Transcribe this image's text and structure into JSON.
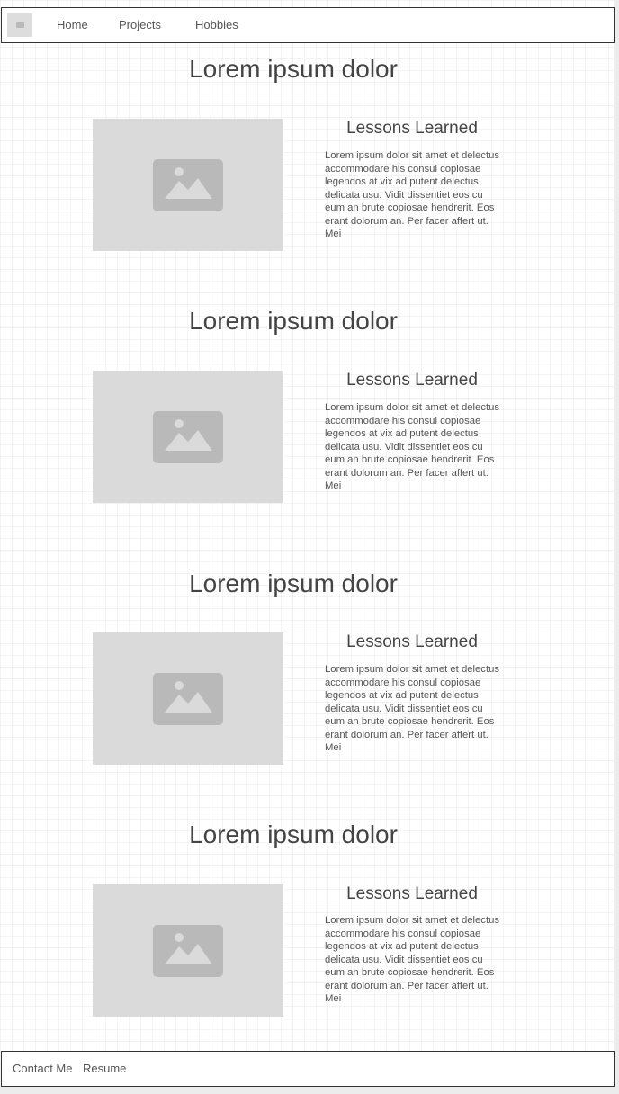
{
  "nav": {
    "logo_icon": "image-placeholder-icon",
    "links": [
      "Home",
      "Projects",
      "Hobbies"
    ]
  },
  "sections": [
    {
      "title": "Lorem ipsum dolor",
      "image_icon": "image-placeholder-icon",
      "subtitle": "Lessons Learned",
      "text": "Lorem ipsum dolor sit amet et delectus accommodare his consul copiosae legendos at vix ad putent delectus delicata usu. Vidit dissentiet eos cu eum an brute copiosae hendrerit. Eos erant dolorum an. Per facer affert ut. Mei"
    },
    {
      "title": "Lorem ipsum dolor",
      "image_icon": "image-placeholder-icon",
      "subtitle": "Lessons Learned",
      "text": "Lorem ipsum dolor sit amet et delectus accommodare his consul copiosae legendos at vix ad putent delectus delicata usu. Vidit dissentiet eos cu eum an brute copiosae hendrerit. Eos erant dolorum an. Per facer affert ut. Mei"
    },
    {
      "title": "Lorem ipsum dolor",
      "image_icon": "image-placeholder-icon",
      "subtitle": "Lessons Learned",
      "text": "Lorem ipsum dolor sit amet et delectus accommodare his consul copiosae legendos at vix ad putent delectus delicata usu. Vidit dissentiet eos cu eum an brute copiosae hendrerit. Eos erant dolorum an. Per facer affert ut. Mei"
    },
    {
      "title": "Lorem ipsum dolor",
      "image_icon": "image-placeholder-icon",
      "subtitle": "Lessons Learned",
      "text": "Lorem ipsum dolor sit amet et delectus accommodare his consul copiosae legendos at vix ad putent delectus delicata usu. Vidit dissentiet eos cu eum an brute copiosae hendrerit. Eos erant dolorum an. Per facer affert ut. Mei"
    }
  ],
  "footer": {
    "links": [
      "Contact Me",
      "Resume"
    ]
  },
  "colors": {
    "text": "#444444",
    "placeholder": "#dadada",
    "placeholder_icon": "#b9b9b9",
    "border": "#333333"
  }
}
